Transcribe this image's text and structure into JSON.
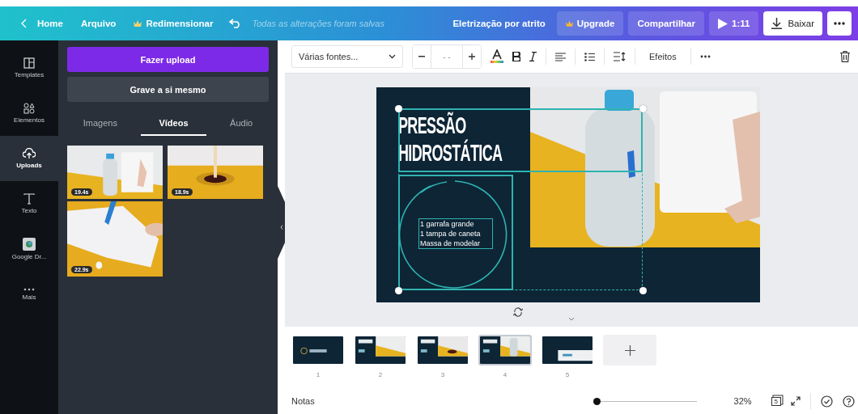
{
  "topbar": {
    "home": "Home",
    "file": "Arquivo",
    "resize": "Redimensionar",
    "save_status": "Todas as alterações foram salvas",
    "title": "Eletrização por atrito",
    "upgrade": "Upgrade",
    "share": "Compartilhar",
    "duration": "1:11",
    "download": "Baixar"
  },
  "rail": [
    {
      "label": "Templates",
      "kind": "templates",
      "selected": false
    },
    {
      "label": "Elementos",
      "kind": "elements",
      "selected": false
    },
    {
      "label": "Uploads",
      "kind": "uploads",
      "selected": true
    },
    {
      "label": "Texto",
      "kind": "text",
      "selected": false
    },
    {
      "label": "Google Dr...",
      "kind": "app",
      "selected": false
    },
    {
      "label": "Mais",
      "kind": "more",
      "selected": false
    }
  ],
  "panel": {
    "upload_button": "Fazer upload",
    "record_button": "Grave a si mesmo",
    "tabs": [
      {
        "label": "Imagens",
        "selected": false
      },
      {
        "label": "Vídeos",
        "selected": true
      },
      {
        "label": "Áudio",
        "selected": false
      }
    ],
    "videos": [
      {
        "duration": "19.4s"
      },
      {
        "duration": "18.9s"
      },
      {
        "duration": "22.9s"
      }
    ]
  },
  "toolbar": {
    "font": "Várias fontes...",
    "font_size": "- -",
    "effects": "Efeitos"
  },
  "slide": {
    "title_lines": [
      "PRESSÃO",
      "HIDROSTÁTICA"
    ],
    "list": [
      "1 garrafa grande",
      "1 tampa de caneta",
      "Massa de modelar"
    ]
  },
  "pages": [
    {
      "number": "1",
      "selected": false
    },
    {
      "number": "2",
      "selected": false
    },
    {
      "number": "3",
      "selected": false
    },
    {
      "number": "4",
      "selected": true
    },
    {
      "number": "5",
      "selected": false
    }
  ],
  "footer": {
    "notes": "Notas",
    "zoom": {
      "level": 0.02
    },
    "zoom_reading": "32%",
    "page_count": "5"
  }
}
